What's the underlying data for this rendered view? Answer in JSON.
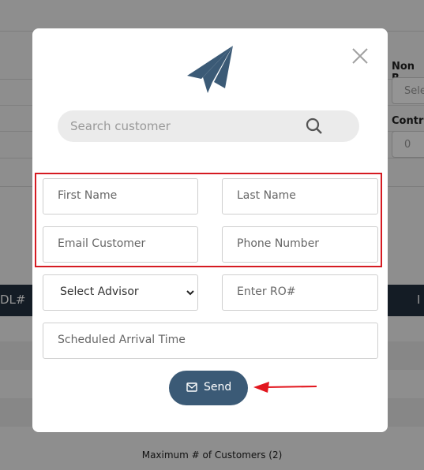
{
  "background": {
    "label_non_r": "Non R",
    "select_placeholder": "Sele",
    "label_contra": "Contra",
    "contra_value": "0",
    "column_dl": "DL#",
    "column_i": "I",
    "footer_text": "Maximum # of Customers (2)"
  },
  "modal": {
    "logo_icon": "paper-plane-icon",
    "search": {
      "placeholder": "Search customer"
    },
    "fields": {
      "first_name": "First Name",
      "last_name": "Last Name",
      "email": "Email Customer",
      "phone": "Phone Number",
      "advisor_select": "Select Advisor",
      "ro": "Enter RO#",
      "arrival": "Scheduled Arrival Time"
    },
    "send_label": "Send"
  },
  "colors": {
    "brand": "#3b5a76",
    "highlight_box": "#d51b22",
    "arrow": "#e2161e"
  }
}
